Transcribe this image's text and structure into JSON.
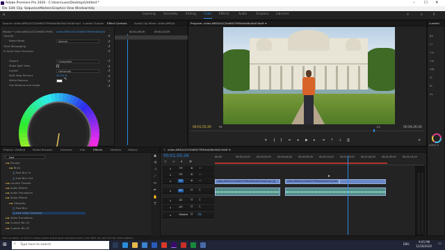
{
  "app": {
    "title": "Adobe Premiere Pro 2020 - C:\\Users\\user\\Desktop\\Untitled *",
    "window_controls": [
      "–",
      "☐",
      "✕"
    ]
  },
  "menu": [
    "File",
    "Edit",
    "Clip",
    "Sequence",
    "Markers",
    "Graphics",
    "View",
    "Window",
    "Help"
  ],
  "workspaces": {
    "tabs": [
      "Learning",
      "Assembly",
      "Editing",
      "Color",
      "Effects",
      "Audio",
      "Graphics",
      "Libraries"
    ],
    "active": "Color"
  },
  "effect_controls": {
    "tabs": [
      "Source: video-6ff42a3125e6927f994eb56a3b07e0df.mp4",
      "Effect Controls",
      "Audio Clip Mixer: video-6ff42a3125e6927f994eb56a3b07e0df",
      "Lumetri Scopes"
    ],
    "master": "Master * video-6ff42a3125e6927f994eb56a3b07e0df.mp4",
    "clip": "video-6ff42a3125e6927f994eb56a3b07e0df.mp4",
    "mini_tc": [
      "00:01;29;29",
      "00:01;14;29"
    ],
    "rows": [
      {
        "label": "Opacity",
        "indent": 0
      },
      {
        "label": "Blend Mode",
        "indent": 2,
        "value": "Normal"
      },
      {
        "label": "Time Remapping",
        "indent": 0
      },
      {
        "label": "fx  Split Color Corrector",
        "indent": 0
      },
      {
        "label": "Output",
        "indent": 2,
        "value": "Composite"
      },
      {
        "label": "Show Split View",
        "indent": 2
      },
      {
        "label": "Layout",
        "indent": 2,
        "value": "Horizontal"
      },
      {
        "label": "Split View Percent",
        "indent": 2,
        "value": "50.00 %"
      },
      {
        "label": "White Balance",
        "indent": 2
      },
      {
        "label": "Hue Balance and Angle",
        "indent": 2
      }
    ],
    "reset_icon": "↺"
  },
  "program_monitor": {
    "title": "Program: video-6ff42a3125e6927f994eb56a3b07e0df ≡",
    "timecode": "00;01;55;26",
    "fit": "Fit",
    "quality": "1/2",
    "duration": "00;04;26;20",
    "lumetri_label": "Lumetri",
    "lumetri_side": [
      "Ba",
      "Cr",
      "Cur",
      "Col",
      "HSL",
      "Vi",
      "Ef",
      "Ev"
    ],
    "lumetri_slider_label": "active X"
  },
  "project": {
    "tabs": [
      "Project: Untitled",
      "Media Browser",
      "Libraries",
      "Info",
      "Effects",
      "Markers",
      "History"
    ],
    "search_value": "fast",
    "tree": [
      {
        "label": "Presets",
        "indent": 1,
        "folder": true
      },
      {
        "label": "Blurs",
        "indent": 2,
        "folder": true
      },
      {
        "label": "Fast Blur In",
        "indent": 3
      },
      {
        "label": "Fast Blur Out",
        "indent": 3
      },
      {
        "label": "Lumetri Presets",
        "indent": 1,
        "folder": true
      },
      {
        "label": "Audio Effects",
        "indent": 1,
        "folder": true
      },
      {
        "label": "Audio Transitions",
        "indent": 1,
        "folder": true
      },
      {
        "label": "Video Effects",
        "indent": 1,
        "folder": true
      },
      {
        "label": "Obsolete",
        "indent": 2,
        "folder": true
      },
      {
        "label": "Fast Blur",
        "indent": 3
      },
      {
        "label": "Fast Color Corrector",
        "indent": 3,
        "selected": true
      },
      {
        "label": "Video Transitions",
        "indent": 1,
        "folder": true
      },
      {
        "label": "Custom Bin 01",
        "indent": 1,
        "folder": true
      },
      {
        "label": "Custom Bin 02",
        "indent": 1,
        "folder": true
      }
    ]
  },
  "timeline": {
    "tab": "video-6ff42a3125e6927f994eb56a3b07e0df ≡",
    "timecode": "00;01;55;26",
    "ruler": [
      "00;00",
      "00;00;14;29",
      "00;00;29;29",
      "00;00;44;28",
      "00;00;59;28",
      "00;01;14;29",
      "00;01;29;29",
      "00;01;44;28",
      "00;01;59;29",
      "00;02;14;29"
    ],
    "tracks": [
      "V3",
      "V2",
      "V1",
      "A1",
      "A2",
      "A3",
      "Master"
    ],
    "master_value": "0.0",
    "clips": [
      {
        "name": "video-6ff42a3125e6927f994eb56a3b07e0df.mp4 [V]",
        "kind": "v",
        "start": 0.0,
        "end": 0.384
      },
      {
        "name": "video-6ff42a3125e6927f994eb56a3b07e0df.mp4 [V]",
        "kind": "v",
        "start": 0.41,
        "end": 0.728
      },
      {
        "name": "",
        "kind": "v",
        "start": 0.728,
        "end": 1.0
      },
      {
        "name": "",
        "kind": "a",
        "start": 0.0,
        "end": 0.384
      },
      {
        "name": "",
        "kind": "a",
        "start": 0.41,
        "end": 1.0
      }
    ],
    "playhead": 0.778
  },
  "statusbar": "Click to select, or click in empty space and drag to marquee select. Use Shift, Alt, and Ctrl for other options.",
  "taskbar": {
    "search_placeholder": "Type here to search",
    "clock_time": "9:05 PM",
    "clock_date": "12/26/2020",
    "lang": "ENG"
  }
}
